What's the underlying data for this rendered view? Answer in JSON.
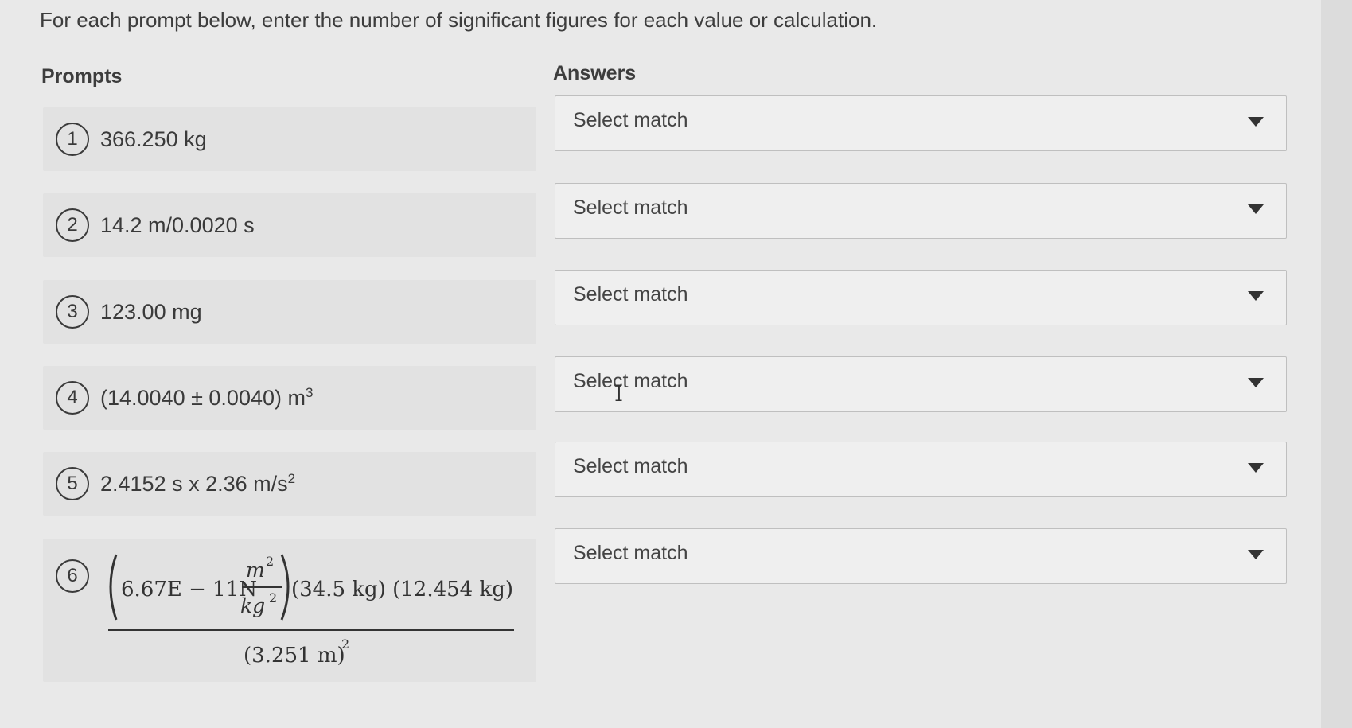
{
  "instructions": "For each prompt below, enter the number of significant figures for each value or calculation.",
  "headers": {
    "prompts": "Prompts",
    "answers": "Answers"
  },
  "prompts": [
    {
      "number": "1",
      "text": "366.250 kg"
    },
    {
      "number": "2",
      "text": "14.2 m/0.0020 s"
    },
    {
      "number": "3",
      "text": "123.00 mg"
    },
    {
      "number": "4",
      "text_main": "(14.0040 ± 0.0040) m",
      "superscript": "3"
    },
    {
      "number": "5",
      "text_main": "2.4152 s x 2.36 m/s",
      "superscript": "2"
    },
    {
      "number": "6",
      "numerator_a": "6.67E − 11N",
      "frac_num": "m",
      "frac_num_exp": "2",
      "frac_den": "kg",
      "frac_den_exp": "2",
      "numerator_b": "(34.5 kg) (12.454 kg)",
      "denominator": "(3.251 m)",
      "denominator_exp": "2"
    }
  ],
  "answers": [
    {
      "label": "Select match"
    },
    {
      "label": "Select match"
    },
    {
      "label": "Select match"
    },
    {
      "label": "Select match"
    },
    {
      "label": "Select match"
    },
    {
      "label": "Select match"
    }
  ]
}
